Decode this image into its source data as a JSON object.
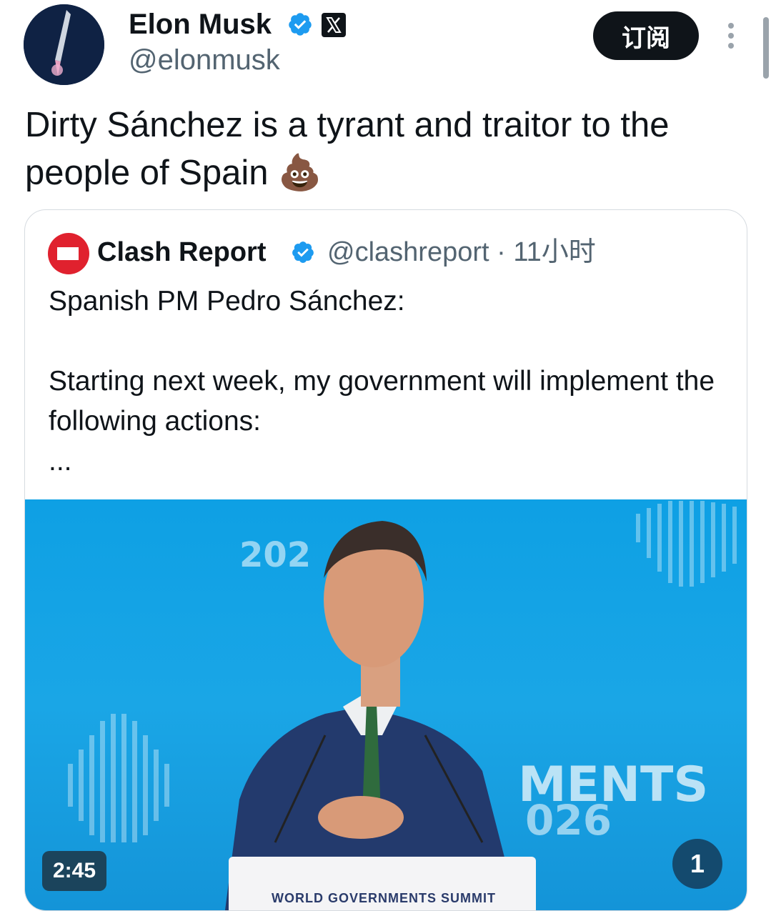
{
  "author": {
    "name": "Elon Musk",
    "handle": "@elonmusk"
  },
  "header": {
    "subscribe_label": "订阅"
  },
  "tweet": {
    "text": "Dirty Sánchez is a tyrant and traitor to the people of Spain 💩"
  },
  "quote": {
    "name": "Clash Report",
    "handle": "@clashreport",
    "time": "11小时",
    "separator": "·",
    "line1": "Spanish PM Pedro Sánchez:",
    "line2": "Starting next week, my government will implement the following actions:",
    "ellipsis": "..."
  },
  "video": {
    "duration": "2:45",
    "page_indicator": "1",
    "bg_year": "202",
    "bg_ments": "MENTS",
    "bg_026": "026",
    "podium_text": "WORLD GOVERNMENTS SUMMIT"
  },
  "colors": {
    "verified": "#1d9bf0",
    "video_bg": "#1aa6e6",
    "clash_red": "#e0212e"
  }
}
